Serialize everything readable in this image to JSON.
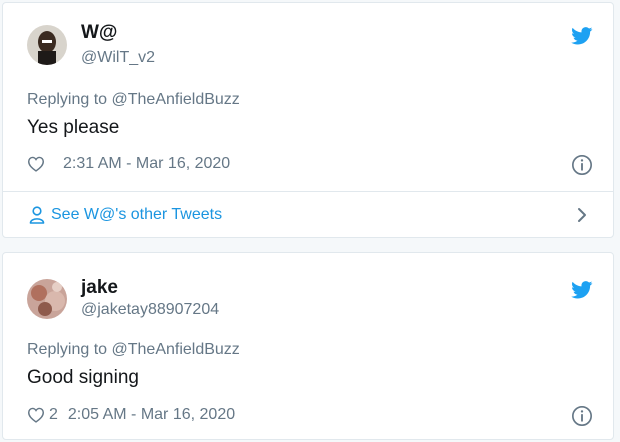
{
  "colors": {
    "twitter_blue": "#1da1f2",
    "link_blue": "#1b95e0",
    "secondary_text": "#657786",
    "primary_text": "#14171a",
    "border": "#e1e8ed"
  },
  "tweets": [
    {
      "display_name": "W@",
      "handle": "@WilT_v2",
      "reply_prefix": "Replying to",
      "reply_to": "@TheAnfieldBuzz",
      "text": "Yes please",
      "like_count": "",
      "timestamp": "2:31 AM - Mar 16, 2020",
      "other_tweets_label": "See W@'s other Tweets",
      "icons": [
        "avatar",
        "twitter-bird-icon",
        "heart-icon",
        "info-icon",
        "person-icon",
        "chevron-right-icon"
      ]
    },
    {
      "display_name": "jake",
      "handle": "@jaketay88907204",
      "reply_prefix": "Replying to",
      "reply_to": "@TheAnfieldBuzz",
      "text": "Good signing",
      "like_count": "2",
      "timestamp": "2:05 AM - Mar 16, 2020",
      "icons": [
        "avatar",
        "twitter-bird-icon",
        "heart-icon",
        "info-icon"
      ]
    }
  ]
}
